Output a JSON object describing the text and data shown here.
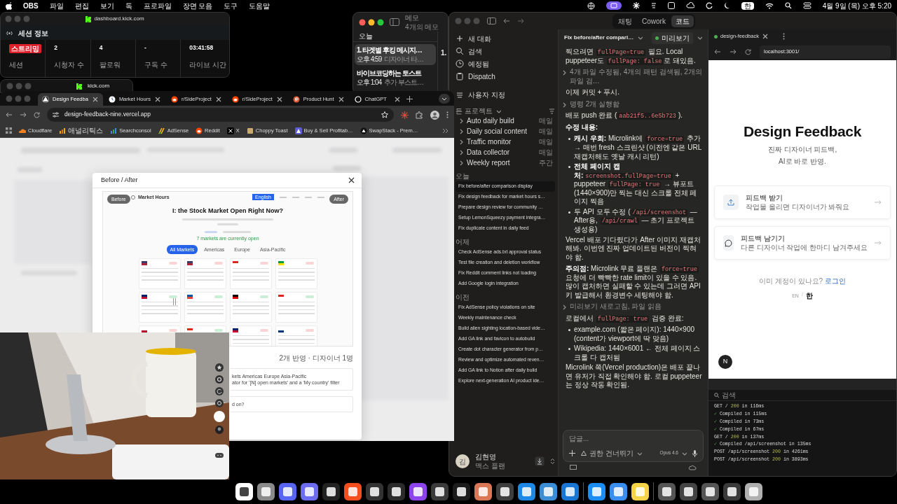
{
  "menu_bar": {
    "app": "OBS",
    "menus": [
      "파일",
      "편집",
      "보기",
      "독",
      "프로파일",
      "장면 모음",
      "도구",
      "도움말"
    ],
    "input_source": "한",
    "clock": "4월 9일 (목) 오후 5:20"
  },
  "kick_dashboard": {
    "title": "dashboard.kick.com",
    "section": "세션 정보",
    "stats": [
      {
        "kind": "badge",
        "value": "스트리밍",
        "label": "세션"
      },
      {
        "kind": "number",
        "value": "2",
        "label": "시청자 수"
      },
      {
        "kind": "number",
        "value": "4",
        "label": "팔로워"
      },
      {
        "kind": "number",
        "value": "-",
        "label": "구독 수"
      },
      {
        "kind": "number",
        "value": "03:41:58",
        "label": "라이브 시간"
      }
    ]
  },
  "kick_window": {
    "title": "kick.com"
  },
  "notes": {
    "title": "메모",
    "subtitle": "4개의 메모",
    "section": "오늘",
    "items": [
      {
        "title": "1. 타겟별 후킹 메시지…",
        "time": "오후 4:59",
        "preview": "디자이너 타…",
        "selected": true
      },
      {
        "title": "바이브코딩하는 토스트",
        "time": "오후 1:04",
        "preview": "추가 부스트…",
        "selected": false
      }
    ],
    "peek": "1."
  },
  "browser": {
    "tabs": [
      {
        "title": "Design Feedba",
        "selected": true
      },
      {
        "title": "Market Hours",
        "selected": false
      },
      {
        "title": "r/SideProject",
        "selected": false
      },
      {
        "title": "r/SideProject",
        "selected": false
      },
      {
        "title": "Product Hunt",
        "selected": false
      },
      {
        "title": "ChatGPT",
        "selected": false
      }
    ],
    "url": "design-feedback-nine.vercel.app",
    "bookmarks": [
      "Cloudflare",
      "애널리틱스",
      "Searchconsol",
      "AdSense",
      "Reddit",
      "X",
      "Choppy Toast",
      "Buy & Sell Profitab…",
      "SwapStack - Prem…"
    ],
    "modal": {
      "title": "Before / After",
      "before_label": "Before",
      "after_label": "After",
      "shot": {
        "brand": "Market Hours",
        "language": "English",
        "headline": "I: the Stock Market Open Right Now?",
        "open_note": "7 markets are currently open",
        "filters": [
          {
            "label": "All Markets",
            "selected": true
          },
          {
            "label": "Americas",
            "selected": false
          },
          {
            "label": "Europe",
            "selected": false
          },
          {
            "label": "Asia-Pacific",
            "selected": false
          }
        ],
        "markets": [
          {
            "open": false
          },
          {
            "open": false
          },
          {
            "open": false
          },
          {
            "open": false
          },
          {
            "open": true
          },
          {
            "open": true
          },
          {
            "open": true
          },
          {
            "open": true
          },
          {
            "open": false
          },
          {
            "open": true
          },
          {
            "open": false
          },
          {
            "open": false
          }
        ]
      },
      "summary": "2개 반영 · 디자이너 1명",
      "feedback": [
        {
          "lines": [
            "kets Americas Europe Asia-Pacific",
            "ator for '[N] open markets' and a 'My country' filter"
          ]
        },
        {
          "lines": [
            "d on?"
          ]
        }
      ]
    }
  },
  "claude": {
    "modes": [
      {
        "label": "채팅",
        "selected": false
      },
      {
        "label": "Cowork",
        "selected": false
      },
      {
        "label": "코드",
        "selected": true
      }
    ],
    "nav": [
      "새 대화",
      "검색",
      "예정됨",
      "Dispatch",
      "사용자 지정"
    ],
    "projects_label": "든 프로젝트",
    "scheduled": [
      {
        "label": "Auto daily build",
        "freq": "매일"
      },
      {
        "label": "Daily social content",
        "freq": "매일"
      },
      {
        "label": "Traffic monitor",
        "freq": "매일"
      },
      {
        "label": "Data collector",
        "freq": "매일"
      },
      {
        "label": "Weekly report",
        "freq": "주간"
      }
    ],
    "session_groups": [
      {
        "label": "오늘",
        "items": [
          {
            "title": "Fix before/after comparison display",
            "selected": true
          },
          {
            "title": "Fix design feedback for market hours s…",
            "selected": false
          },
          {
            "title": "Prepare design review for community …",
            "selected": false
          },
          {
            "title": "Setup LemonSqueezy payment integra…",
            "selected": false
          },
          {
            "title": "Fix duplicate content in daily feed",
            "selected": false
          }
        ]
      },
      {
        "label": "어제",
        "items": [
          {
            "title": "Check AdSense ads.txt approval status",
            "selected": false
          },
          {
            "title": "Test file creation and deletion workflow",
            "selected": false
          },
          {
            "title": "Fix Reddit comment links not loading",
            "selected": false
          },
          {
            "title": "Add Google login integration",
            "selected": false
          }
        ]
      },
      {
        "label": "이전",
        "items": [
          {
            "title": "Fix AdSense policy violations on site",
            "selected": false
          },
          {
            "title": "Weekly maintenance check",
            "selected": false
          },
          {
            "title": "Build alien sighting location-based vide…",
            "selected": false
          },
          {
            "title": "Add GA link and favicon to autobuild",
            "selected": false
          },
          {
            "title": "Create dot character generator from p…",
            "selected": false
          },
          {
            "title": "Review and optimize automated reven…",
            "selected": false
          },
          {
            "title": "Add GA link to Notion after daily build",
            "selected": false
          },
          {
            "title": "Explore next-generation AI product ide…",
            "selected": false
          }
        ]
      }
    ],
    "user": {
      "initial": "김",
      "name": "김현영",
      "plan": "맥스 플랜"
    },
    "chat": {
      "title": "Fix before/after compari…",
      "preview_label": "미리보기",
      "preview_live": true,
      "messages": [
        {
          "kind": "paragraph",
          "parts": [
            {
              "kind": "text",
              "text": "찍으려면 "
            },
            {
              "kind": "code",
              "text": "fullPage=true"
            },
            {
              "kind": "text",
              "text": " 필요. Local puppeteer도 "
            },
            {
              "kind": "code",
              "text": "fullPage: false"
            },
            {
              "kind": "text",
              "text": "로 돼있음."
            }
          ]
        },
        {
          "kind": "tool",
          "text": "4개 파일 수정됨, 4개의 패턴 검색됨, 2개의 파일 검…"
        },
        {
          "kind": "paragraph",
          "parts": [
            {
              "kind": "text",
              "text": "이제 커밋 + 푸시."
            }
          ]
        },
        {
          "kind": "tool",
          "text": "명령 2개 실행함"
        },
        {
          "kind": "paragraph",
          "parts": [
            {
              "kind": "text",
              "text": "배포 push 완료 ("
            },
            {
              "kind": "code",
              "text": "aab21f5..6e5b723"
            },
            {
              "kind": "text",
              "text": ")."
            }
          ]
        },
        {
          "kind": "paragraph",
          "parts": [
            {
              "kind": "bold",
              "text": "수정 내용:"
            }
          ]
        },
        {
          "kind": "bullets",
          "items": [
            [
              {
                "kind": "bold",
                "text": "캐시 우회:"
              },
              {
                "kind": "text",
                "text": " Microlink에 "
              },
              {
                "kind": "code",
                "text": "force=true"
              },
              {
                "kind": "text",
                "text": " 추가 → 매번 fresh 스크린샷 (이전엔 같은 URL 재캡처해도 옛날 캐시 리턴)"
              }
            ],
            [
              {
                "kind": "bold",
                "text": "전체 페이지 캡처:"
              },
              {
                "kind": "code",
                "text": "screenshot.fullPage=true"
              },
              {
                "kind": "text",
                "text": " + puppeteer "
              },
              {
                "kind": "code",
                "text": "fullPage: true"
              },
              {
                "kind": "text",
                "text": " → 뷰포트(1440×900)만 찍는 대신 스크롤 전체 페이지 찍음"
              }
            ],
            [
              {
                "kind": "text",
                "text": "두 API 모두 수정 ("
              },
              {
                "kind": "code",
                "text": "/api/screenshot"
              },
              {
                "kind": "text",
                "text": " — After용, "
              },
              {
                "kind": "code",
                "text": "/api/crawl"
              },
              {
                "kind": "text",
                "text": " — 초기 프로젝트 생성용)"
              }
            ]
          ]
        },
        {
          "kind": "paragraph",
          "parts": [
            {
              "kind": "text",
              "text": "Vercel 배포 기다렸다가 After 이미지 재캡처해봐. 이번엔 진짜 업데이트된 버전이 찍혀야 함."
            }
          ]
        },
        {
          "kind": "paragraph",
          "parts": [
            {
              "kind": "bold",
              "text": "주의점:"
            },
            {
              "kind": "text",
              "text": " Microlink 무료 플랜은 "
            },
            {
              "kind": "code",
              "text": "force=true"
            },
            {
              "kind": "text",
              "text": " 요청에 더 빡빡한 rate limit이 있을 수 있음. 많이 캡처하면 실패할 수 있는데 그러면 API 키 발급해서 환경변수 세팅해야 함."
            }
          ]
        },
        {
          "kind": "tool",
          "text": "미리보기 새로고침, 파일 읽음"
        },
        {
          "kind": "paragraph",
          "parts": [
            {
              "kind": "text",
              "text": "로컬에서 "
            },
            {
              "kind": "code",
              "text": "fullPage: true"
            },
            {
              "kind": "text",
              "text": " 검증 완료:"
            }
          ]
        },
        {
          "kind": "bullets",
          "items": [
            [
              {
                "kind": "text",
                "text": "example.com (짧은 페이지): 1440×900 (content가 viewport에 딱 맞음)"
              }
            ],
            [
              {
                "kind": "text",
                "text": "Wikipedia: 1440×6001 ← 전체 페이지 스크롤 다 캡처됨"
              }
            ]
          ]
        },
        {
          "kind": "paragraph",
          "parts": [
            {
              "kind": "text",
              "text": "Microlink 쪽(Vercel production)은 배포 끝나면 유저가 직접 확인해야 함. 로컬 puppeteer는 정상 작동 확인됨."
            }
          ]
        }
      ],
      "composer": {
        "placeholder": "답글...",
        "permission": "권한 건너뛰기",
        "model": "Opus 4.6"
      }
    },
    "preview": {
      "tab": "design-feedback",
      "running": true,
      "url": "localhost:3001/",
      "page": {
        "title": "Design Feedback",
        "subtitle_lines": [
          "진짜 디자이너 피드백,",
          "AI로 바로 반영."
        ],
        "options": [
          {
            "kind": "upload",
            "title": "피드백 받기",
            "desc": "작업물 올리면 디자이너가 봐줘요"
          },
          {
            "kind": "chat",
            "title": "피드백 남기기",
            "desc": "다른 디자이너 작업에 한마디 남겨주세요"
          }
        ],
        "login_prompt": "이미 계정이 있나요?",
        "login_link": "로그인",
        "languages": [
          {
            "label": "EN",
            "selected": false
          },
          {
            "label": "한",
            "selected": true
          }
        ],
        "separator": "/",
        "dev_badge": "N"
      },
      "terminal": {
        "search": "검색",
        "lines": [
          [
            {
              "kind": "plain",
              "text": "GET / "
            },
            {
              "kind": "status",
              "text": "200"
            },
            {
              "kind": "plain",
              "text": " in 116ms"
            }
          ],
          [
            {
              "kind": "check",
              "text": "✓"
            },
            {
              "kind": "plain",
              "text": " Compiled in 115ms"
            }
          ],
          [
            {
              "kind": "check",
              "text": "✓"
            },
            {
              "kind": "plain",
              "text": " Compiled in 73ms"
            }
          ],
          [
            {
              "kind": "check",
              "text": "✓"
            },
            {
              "kind": "plain",
              "text": " Compiled in 67ms"
            }
          ],
          [
            {
              "kind": "plain",
              "text": "GET / "
            },
            {
              "kind": "status",
              "text": "200"
            },
            {
              "kind": "plain",
              "text": " in 137ms"
            }
          ],
          [
            {
              "kind": "check",
              "text": "✓"
            },
            {
              "kind": "plain",
              "text": " Compiled /api/screenshot in 135ms"
            }
          ],
          [
            {
              "kind": "plain",
              "text": "POST /api/screenshot "
            },
            {
              "kind": "status",
              "text": "200"
            },
            {
              "kind": "plain",
              "text": " in 4261ms"
            }
          ],
          [
            {
              "kind": "plain",
              "text": "POST /api/screenshot "
            },
            {
              "kind": "status",
              "text": "200"
            },
            {
              "kind": "plain",
              "text": " in 3893ms"
            }
          ]
        ]
      }
    }
  }
}
